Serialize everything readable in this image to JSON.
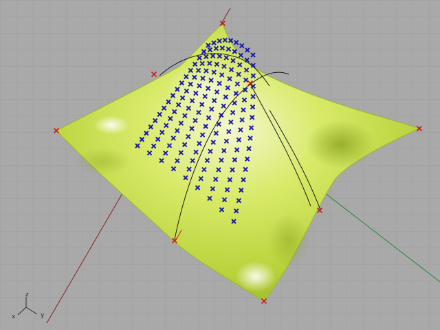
{
  "viewport": {
    "background_color": "#a9a9a9",
    "grid_color": "#a3a3a3",
    "surface_color": "#c9e04a",
    "surface_highlight": "#f2f7c8",
    "surface_shadow": "#8faa1f",
    "point_grid_color": "#1a1aa8",
    "control_point_color": "#cc1a1a",
    "curve_color": "#1b1b1b",
    "x_axis_color": "#8a2020",
    "y_axis_color": "#1f8a3a"
  },
  "axis_icon": {
    "z_label": "z",
    "x_label": "x",
    "y_label": "y"
  }
}
